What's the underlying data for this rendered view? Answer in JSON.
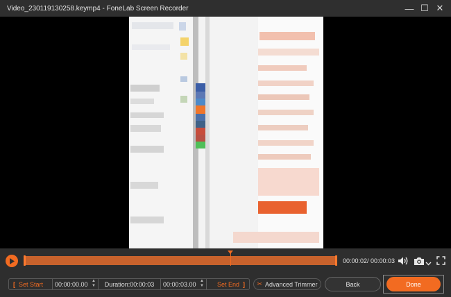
{
  "window": {
    "file_name": "Video_230119130258.keymp4",
    "separator": "-",
    "app_name": "FoneLab Screen Recorder",
    "controls": {
      "minimize": "—",
      "maximize": "☐",
      "close": "✕"
    }
  },
  "player": {
    "time_readout": "00:00:02/ 00:00:03",
    "playhead_fraction": 0.66,
    "accent_color": "#f26b21"
  },
  "trim": {
    "set_start_label": "Set Start",
    "start_time": "00:00:00.00",
    "duration_text": "Duration:00:00:03",
    "end_time": "00:00:03.00",
    "set_end_label": "Set End",
    "advanced_trimmer_label": "Advanced Trimmer"
  },
  "actions": {
    "back_label": "Back",
    "done_label": "Done"
  },
  "icons": {
    "play": "play-icon",
    "volume": "volume-icon",
    "snapshot": "camera-icon",
    "fullscreen": "fullscreen-icon",
    "scissors": "scissors-icon"
  }
}
